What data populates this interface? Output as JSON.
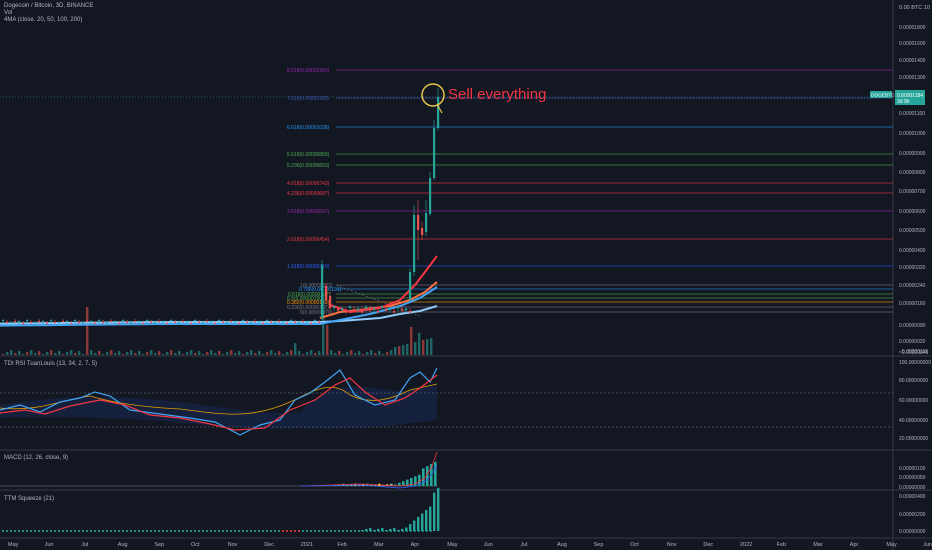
{
  "header": {
    "symbol_line": "Dogecoin / Bitcoin, 3D, BINANCE",
    "vol_label": "Vol",
    "ma_label": "4MA (close, 20, 50, 100, 200)"
  },
  "price_axis": {
    "unit_label": "0.00 BTC",
    "unit_suffix": "10",
    "ticks": [
      "0.00001800",
      "0.00001600",
      "0.00001400",
      "0.00001300",
      "0.00001100",
      "0.00001000",
      "0.00000900",
      "0.00000800",
      "0.00000700",
      "0.00000600",
      "0.00000500",
      "0.00000400",
      "0.00000320",
      "0.00000240",
      "0.00000160",
      "0.00000090",
      "0.00000020",
      "−0.00000045",
      "−0.00000110"
    ],
    "current_tag_label": "DOGEBTC",
    "current_price": "0.00001184",
    "current_time": "3d 9h"
  },
  "annotation": {
    "text": "Sell everything",
    "color": "#f23645",
    "circle_color": "#e8c547"
  },
  "fib_levels": [
    {
      "label": "8.618(0.00001342)",
      "color": "#9c27b0"
    },
    {
      "label": "7.618(0.00001189)",
      "color": "#3f51b5"
    },
    {
      "label": "6.618(0.00001038)",
      "color": "#2196f3"
    },
    {
      "label": "5.618(0.00000889)",
      "color": "#4caf50"
    },
    {
      "label": "5.236(0.00000833)",
      "color": "#4caf50"
    },
    {
      "label": "4.618(0.00000743)",
      "color": "#f23645"
    },
    {
      "label": "4.236(0.00000687)",
      "color": "#f23645"
    },
    {
      "label": "3.618(0.00000597)",
      "color": "#9c27b0"
    },
    {
      "label": "2.618(0.00000454)",
      "color": "#f23645"
    },
    {
      "label": "1.618(0.00000310)",
      "color": "#2962ff"
    },
    {
      "label": "1(0.00000222)",
      "color": "#787b86"
    },
    {
      "label": "0.786(0.00000191)",
      "color": "#2196f3"
    },
    {
      "label": "0.618(0.00000167)",
      "color": "#4caf50"
    },
    {
      "label": "0.5(0.00000150)",
      "color": "#4caf50"
    },
    {
      "label": "0.382(0.00000133)",
      "color": "#ff9800"
    },
    {
      "label": "0.236(0.00000112)",
      "color": "#787b86"
    },
    {
      "label": "0(0.00000078)",
      "color": "#787b86"
    }
  ],
  "tdi": {
    "title": "TDI RSI TuanLouis (13, 34, 2, 7, 5)",
    "ticks": [
      "100.00000000",
      "80.00000000",
      "60.00000000",
      "40.00000000",
      "20.00000000"
    ]
  },
  "macd": {
    "title": "MACD (12, 26, close, 9)",
    "ticks": [
      "0.00000100",
      "0.00000050",
      "0.00000000"
    ]
  },
  "squeeze": {
    "title": "TTM Squeeze (21)",
    "ticks": [
      "0.00000400",
      "0.00000200",
      "0.00000000"
    ]
  },
  "time_axis": [
    "May",
    "Jun",
    "Jul",
    "Aug",
    "Sep",
    "Oct",
    "Nov",
    "Dec",
    "2021",
    "Feb",
    "Mar",
    "Apr",
    "May",
    "Jun",
    "Jul",
    "Aug",
    "Sep",
    "Oct",
    "Nov",
    "Dec",
    "2022",
    "Feb",
    "Mar",
    "Apr",
    "May",
    "Jun"
  ],
  "colors": {
    "up": "#26a69a",
    "down": "#ef5350",
    "ma20": "#f23645",
    "ma50": "#ff7043",
    "ma100": "#42a5f5",
    "ma200": "#90caf9",
    "tdi_fast": "#42a5f5",
    "tdi_slow": "#f23645"
  },
  "chart_data": [
    {
      "type": "candlestick",
      "title": "Dogecoin / Bitcoin, 3D, BINANCE",
      "dates": [
        "2020-05",
        "2020-06",
        "2020-07",
        "2020-08",
        "2020-09",
        "2020-10",
        "2020-11",
        "2020-12",
        "2021-01",
        "2021-02",
        "2021-03",
        "2021-04a",
        "2021-04b",
        "2021-04c",
        "2021-04d",
        "2021-05a",
        "2021-05b"
      ],
      "close": [
        2.6e-07,
        2.6e-07,
        3e-07,
        2.8e-07,
        2.7e-07,
        2.6e-07,
        2.5e-07,
        2.2e-07,
        2.2e-07,
        9e-07,
        1e-06,
        1.7e-06,
        5.6e-06,
        6e-06,
        8e-06,
        1e-05,
        1.184e-05
      ],
      "current_price": 1.184e-05,
      "annotation": "Sell everything"
    },
    {
      "type": "line",
      "title": "TDI RSI TuanLouis (13, 34, 2, 7, 5)",
      "ylim": [
        15,
        100
      ],
      "series": [
        {
          "values": [
            55,
            58,
            52,
            60,
            45,
            50,
            42,
            38,
            40,
            80,
            70,
            55,
            60,
            78,
            85,
            92
          ]
        },
        {
          "values": [
            52,
            56,
            55,
            55,
            48,
            48,
            44,
            40,
            42,
            70,
            75,
            60,
            58,
            72,
            82,
            88
          ]
        }
      ]
    },
    {
      "type": "bar",
      "title": "MACD (12, 26, close, 9)",
      "values": [
        0,
        0,
        0,
        0,
        0,
        0,
        0,
        0,
        0,
        5e-08,
        8e-08,
        1e-07,
        3e-07,
        6e-07,
        9e-07,
        1.2e-06
      ]
    },
    {
      "type": "bar",
      "title": "TTM Squeeze (21)",
      "values": [
        0,
        0,
        0,
        0,
        0,
        0,
        0,
        0,
        0,
        1e-07,
        1.5e-07,
        2e-07,
        8e-07,
        1.5e-06,
        2.5e-06,
        4.2e-06
      ]
    }
  ]
}
